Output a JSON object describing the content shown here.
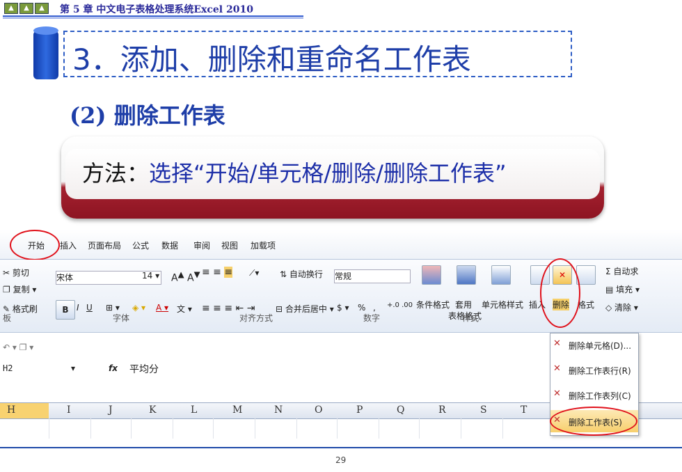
{
  "header": {
    "chapter": "第 5 章   中文电子表格处理系统Excel 2010"
  },
  "slide": {
    "title": "3．添加、删除和重命名工作表",
    "subtitle": "(2) 删除工作表",
    "method_label": "方法：",
    "method_value": "选择“开始/单元格/删除/删除工作表”"
  },
  "excel": {
    "tabs": [
      "开始",
      "插入",
      "页面布局",
      "公式",
      "数据",
      "审阅",
      "视图",
      "加载项"
    ],
    "clipboard": {
      "cut": "剪切",
      "copy": "复制",
      "format_painter": "格式刷",
      "group": "板"
    },
    "font": {
      "name": "宋体",
      "size": "14",
      "group": "字体",
      "bold": "B",
      "italic": "I",
      "underline": "U",
      "phonetic": "wén"
    },
    "alignment": {
      "wrap": "自动换行",
      "merge": "合并后居中",
      "group": "对齐方式"
    },
    "number": {
      "format": "常规",
      "percent": "%",
      "comma": ",",
      "group": "数字"
    },
    "styles": {
      "conditional": "条件格式",
      "table": "套用",
      "table2": "表格格式",
      "cell_styles": "单元格样式",
      "group": "样式"
    },
    "cells": {
      "insert": "插入",
      "delete": "删除",
      "format": "格式"
    },
    "editing": {
      "autosum": "Σ 自动求",
      "fill": "填充",
      "clear": "清除"
    },
    "name_box": "H2",
    "fx": "fx",
    "formula_value": "平均分",
    "columns": [
      "H",
      "I",
      "J",
      "K",
      "L",
      "M",
      "N",
      "O",
      "P",
      "Q",
      "R",
      "S",
      "T"
    ],
    "delete_menu": [
      "删除单元格(D)...",
      "删除工作表行(R)",
      "删除工作表列(C)",
      "删除工作表(S)"
    ]
  },
  "footer": {
    "page_number": "29"
  }
}
